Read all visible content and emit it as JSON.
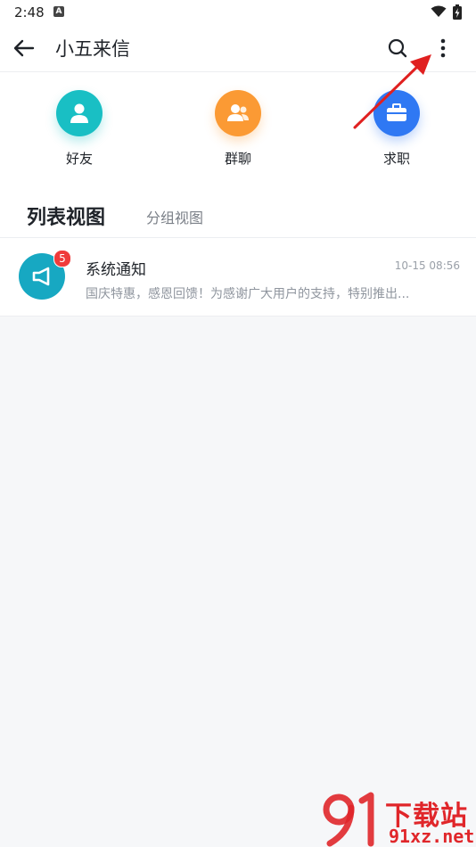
{
  "status_bar": {
    "time": "2:48",
    "notification_glyph": "A"
  },
  "app_bar": {
    "title": "小五来信"
  },
  "quick_actions": [
    {
      "label": "好友",
      "color": "#19bfc4",
      "icon": "person-icon"
    },
    {
      "label": "群聊",
      "color": "#fb9a34",
      "icon": "group-icon"
    },
    {
      "label": "求职",
      "color": "#2f78f3",
      "icon": "briefcase-icon"
    }
  ],
  "tabs": {
    "list_view": "列表视图",
    "group_view": "分组视图"
  },
  "messages": [
    {
      "title": "系统通知",
      "time": "10-15 08:56",
      "preview": "国庆特惠，感恩回馈！为感谢广大用户的支持，特别推出...",
      "badge": "5",
      "avatar_color": "#17a8c2",
      "icon": "speaker-icon"
    }
  ],
  "watermark": {
    "line1": "下载站",
    "line2": "91xz.net",
    "logo_text": "91"
  },
  "colors": {
    "annotation_arrow": "#e02020",
    "badge": "#ef3b3b"
  }
}
